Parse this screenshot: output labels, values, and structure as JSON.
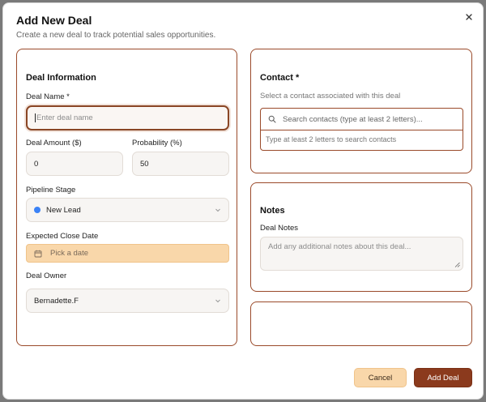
{
  "dialog": {
    "title": "Add New Deal",
    "subtitle": "Create a new deal to track potential sales opportunities.",
    "close_icon": "close-icon"
  },
  "deal_info": {
    "title": "Deal Information",
    "name_label": "Deal Name *",
    "name_placeholder": "Enter deal name",
    "amount_label": "Deal Amount ($)",
    "amount_value": "0",
    "probability_label": "Probability (%)",
    "probability_value": "50",
    "stage_label": "Pipeline Stage",
    "stage_value": "New Lead",
    "stage_dot_color": "#3b82f6",
    "close_date_label": "Expected Close Date",
    "close_date_placeholder": "Pick a date",
    "owner_label": "Deal Owner",
    "owner_value": "Bernadette.F"
  },
  "contact": {
    "title": "Contact *",
    "help": "Select a contact associated with this deal",
    "search_placeholder": "Search contacts (type at least 2 letters)...",
    "hint": "Type at least 2 letters to search contacts"
  },
  "notes": {
    "title": "Notes",
    "label": "Deal Notes",
    "placeholder": "Add any additional notes about this deal..."
  },
  "actions": {
    "cancel": "Cancel",
    "add": "Add Deal"
  },
  "colors": {
    "accent": "#8b3a1d",
    "date_bg": "#f9d7aa"
  }
}
